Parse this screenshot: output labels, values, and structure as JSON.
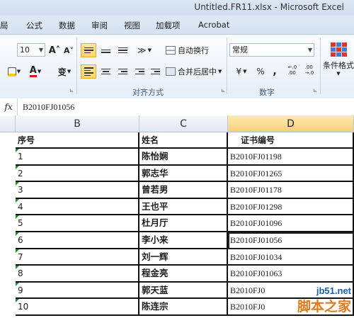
{
  "window": {
    "title": "Untitled.FR11.xlsx  -  Microsoft Excel"
  },
  "tabs": [
    "局",
    "公式",
    "数据",
    "审阅",
    "视图",
    "加载项",
    "Acrobat"
  ],
  "ribbon": {
    "font_size": "10",
    "grow_font_icon": "A˄",
    "shrink_font_icon": "A˅",
    "font_color_glyph": "A",
    "phonetic_glyph": "变",
    "orientation_glyph": "≫",
    "wrap_text": "自动换行",
    "merge_center": "合并后居中",
    "number_format": "常规",
    "currency_glyph": "¥",
    "percent_glyph": "%",
    "comma_glyph": ",",
    "increase_decimal": "←.0\n.00",
    "decrease_decimal": ".00\n→.0",
    "conditional_format": "条件格式",
    "group_alignment": "对齐方式",
    "group_number": "数字"
  },
  "formula_bar": {
    "fx": "fx",
    "value": "B2010FJ01056"
  },
  "columns": [
    "B",
    "C",
    "D"
  ],
  "header_row": [
    "序号",
    "姓名",
    "证书编号"
  ],
  "rows": [
    [
      "1",
      "陈怡娴",
      "B2010FJ01198"
    ],
    [
      "2",
      "郭志华",
      "B2010FJ01265"
    ],
    [
      "3",
      "曾若男",
      "B2010FJ01178"
    ],
    [
      "4",
      "王也平",
      "B2010FJ01298"
    ],
    [
      "5",
      "杜月厅",
      "B2010FJ01096"
    ],
    [
      "6",
      "李小来",
      "B2010FJ01056"
    ],
    [
      "7",
      "刘一辉",
      "B2010FJ01034"
    ],
    [
      "8",
      "程金亮",
      "B2010FJ01063"
    ],
    [
      "9",
      "郭天蓝",
      "B2010FJ0"
    ],
    [
      "10",
      "陈连宗",
      "B2010FJ0"
    ]
  ],
  "watermark": {
    "url": "jb51.net",
    "cn": "脚本之家"
  }
}
